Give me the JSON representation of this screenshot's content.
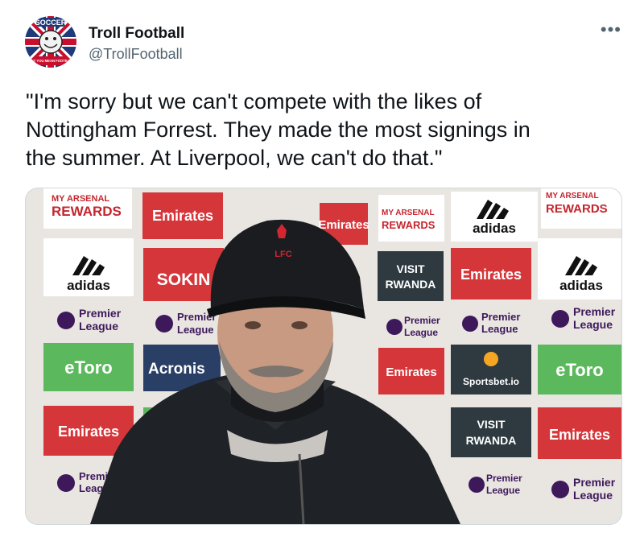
{
  "tweet": {
    "display_name": "Troll Football",
    "handle": "@TrollFootball",
    "more_icon": "more-horizontal-icon",
    "text": "\"I'm sorry but we can't compete with the likes of\nNottingham Forrest. They made the most signings in\nthe summer. At Liverpool, we can't do that.\""
  },
  "avatar": {
    "top_text": "SOCCER",
    "bottom_text": "DON'T YOU MEAN FOOTBALL?"
  },
  "backdrop": {
    "emirates": "Emirates",
    "adidas": "adidas",
    "premier_1": "Premier",
    "premier_2": "League",
    "etoro": "eToro",
    "sokin": "SOKIN",
    "visit": "VISIT",
    "rwanda": "RWANDA",
    "arsenal_1": "MY ARSENAL",
    "arsenal_2": "REWARDS",
    "acronis": "Acronis",
    "sportsbet": "Sportsbet.io",
    "cap_text": "LFC"
  },
  "colors": {
    "emirates_red": "#d5363a",
    "etoro_green": "#5cb85c",
    "rwanda_dark": "#2e3a40",
    "acronis_blue": "#2a3f66"
  }
}
